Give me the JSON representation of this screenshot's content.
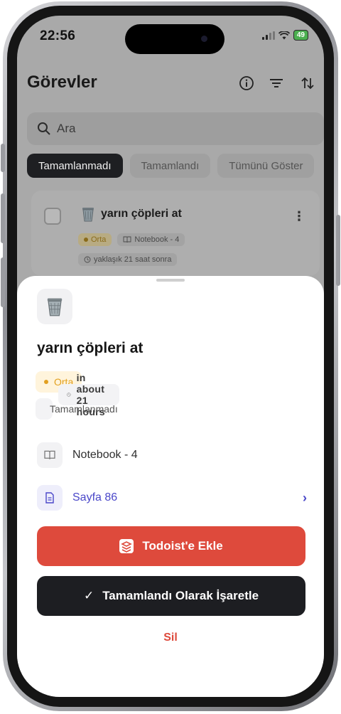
{
  "status_bar": {
    "time": "22:56",
    "battery": "49"
  },
  "header": {
    "title": "Görevler",
    "icons": [
      "info-icon",
      "filter-icon",
      "sort-icon"
    ]
  },
  "search": {
    "placeholder": "Ara"
  },
  "tabs": [
    {
      "label": "Tamamlanmadı",
      "active": true
    },
    {
      "label": "Tamamlandı",
      "active": false
    },
    {
      "label": "Tümünü Göster",
      "active": false
    }
  ],
  "task_card": {
    "title": "yarın çöpleri at",
    "priority": "Orta",
    "notebook": "Notebook - 4",
    "due": "yaklaşık 21 saat sonra"
  },
  "sheet": {
    "title": "yarın çöpleri at",
    "priority": "Orta",
    "due": "in about 21 hours",
    "status": "Tamamlanmadı",
    "notebook": "Notebook - 4",
    "page": "Sayfa 86",
    "todoist_button": "Todoist'e Ekle",
    "complete_button": "Tamamlandı Olarak İşaretle",
    "delete_button": "Sil"
  },
  "colors": {
    "accent_red": "#de4a3c",
    "dark": "#1d1e22",
    "link": "#4a47c9",
    "priority": "#e2a020"
  }
}
